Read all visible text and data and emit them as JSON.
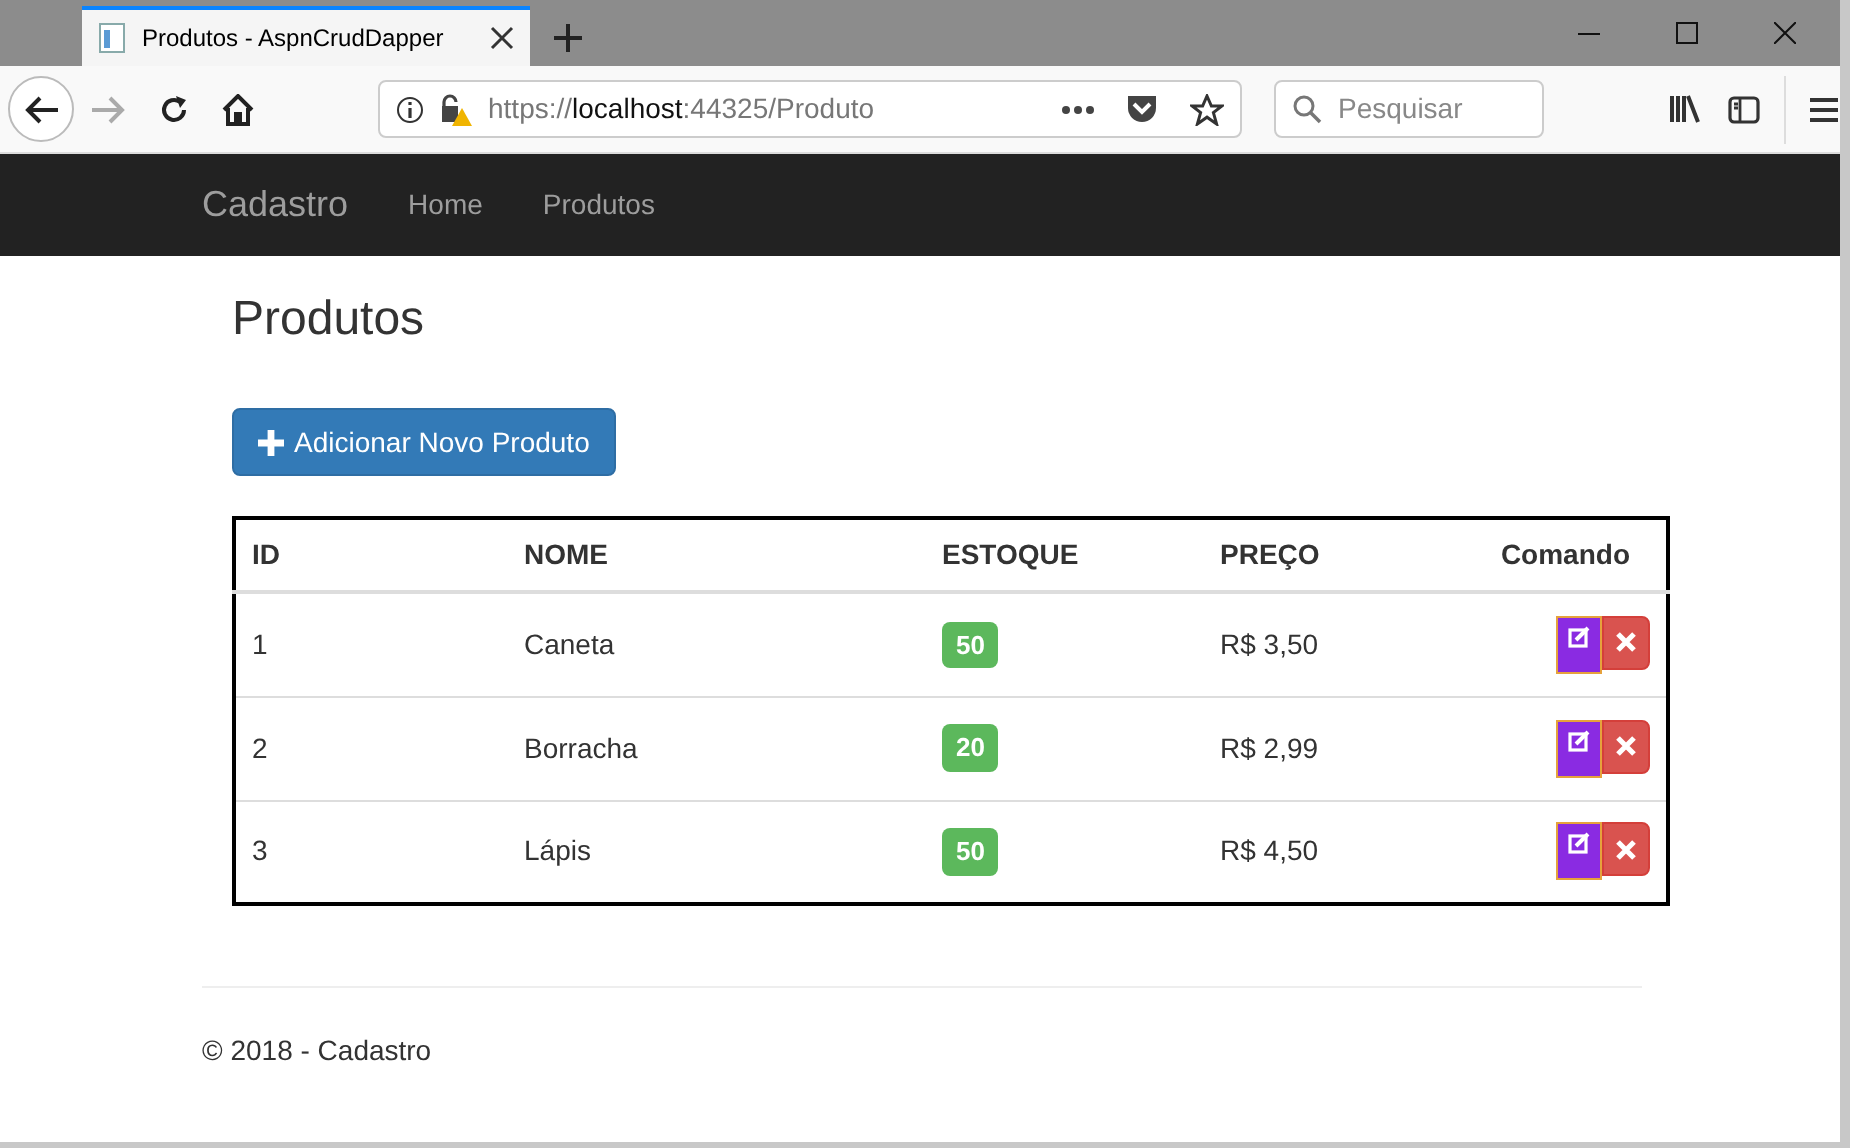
{
  "browser": {
    "tab_title": "Produtos - AspnCrudDapper",
    "url": {
      "scheme": "https://",
      "host": "localhost",
      "rest": ":44325/Produto"
    },
    "search_placeholder": "Pesquisar"
  },
  "navbar": {
    "brand": "Cadastro",
    "links": [
      {
        "label": "Home"
      },
      {
        "label": "Produtos"
      }
    ]
  },
  "page": {
    "heading": "Produtos",
    "add_button": "Adicionar Novo Produto"
  },
  "table": {
    "columns": [
      "ID",
      "NOME",
      "ESTOQUE",
      "PREÇO",
      "Comando"
    ],
    "rows": [
      {
        "id": "1",
        "nome": "Caneta",
        "estoque": "50",
        "preco": "R$ 3,50"
      },
      {
        "id": "2",
        "nome": "Borracha",
        "estoque": "20",
        "preco": "R$ 2,99"
      },
      {
        "id": "3",
        "nome": "Lápis",
        "estoque": "50",
        "preco": "R$ 4,50"
      }
    ]
  },
  "footer": "© 2018 - Cadastro"
}
